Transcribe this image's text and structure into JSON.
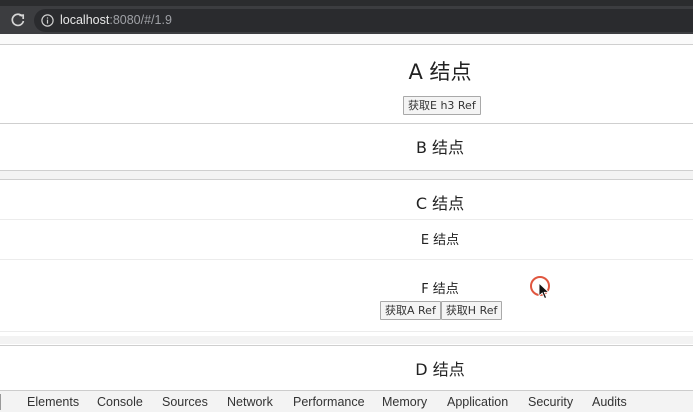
{
  "browser": {
    "url_host": "localhost",
    "url_rest": ":8080/#/1.9"
  },
  "nodes": {
    "a": {
      "title": "A 结点",
      "button": "获取E h3 Ref"
    },
    "b": {
      "title": "B 结点"
    },
    "c": {
      "title": "C 结点"
    },
    "e": {
      "title": "E 结点"
    },
    "f": {
      "title": "F 结点",
      "buttons": [
        "获取A Ref",
        "获取H Ref"
      ]
    },
    "d": {
      "title": "D 结点"
    }
  },
  "devtools": {
    "tabs": [
      "Elements",
      "Console",
      "Sources",
      "Network",
      "Performance",
      "Memory",
      "Application",
      "Security",
      "Audits"
    ]
  }
}
